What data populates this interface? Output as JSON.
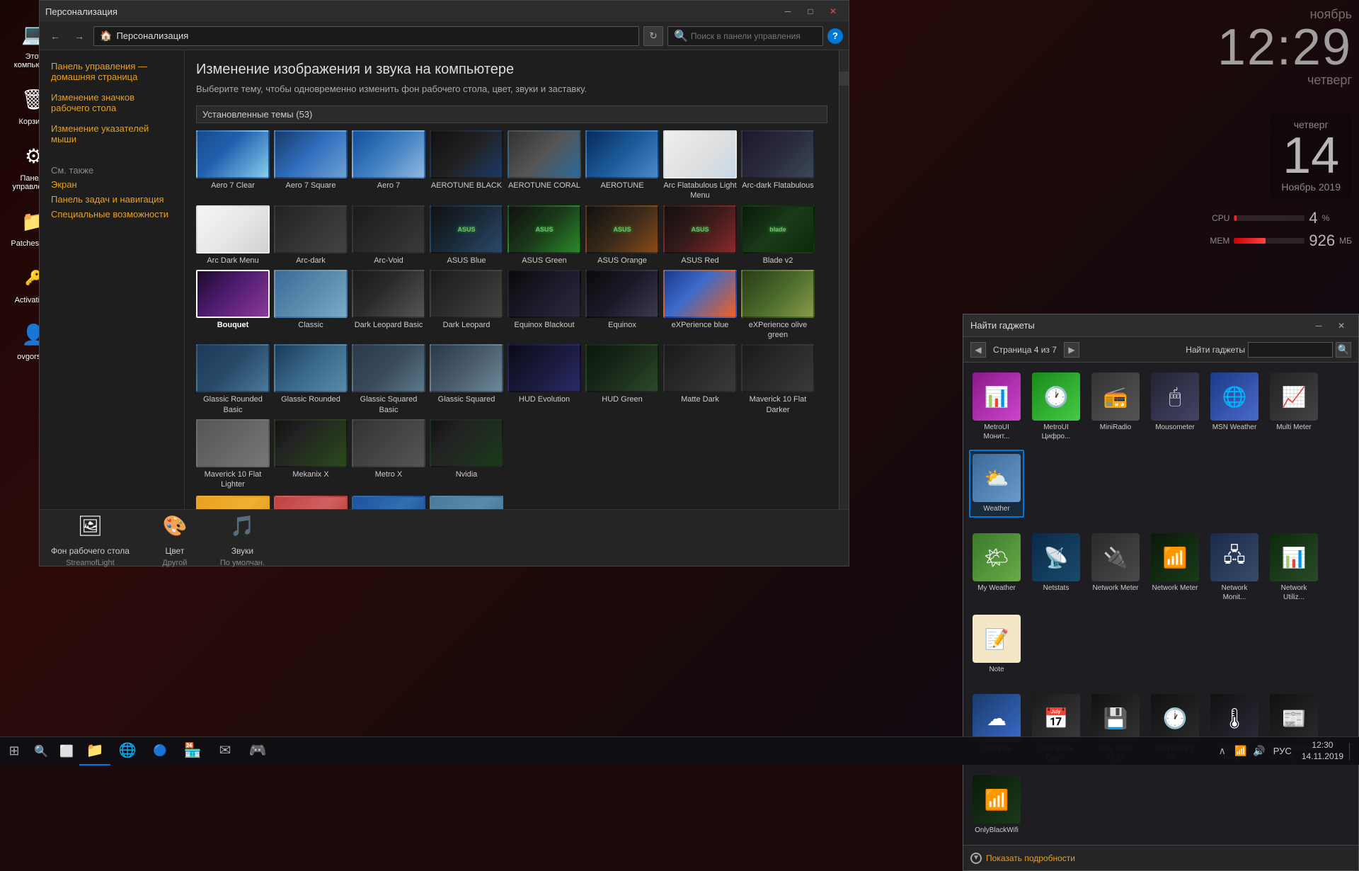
{
  "desktop": {
    "icons": [
      {
        "id": "computer",
        "label": "Этот компьютер",
        "icon": "💻"
      },
      {
        "id": "basket",
        "label": "Корзина",
        "icon": "🗑"
      },
      {
        "id": "control-panel",
        "label": "Панель управления",
        "icon": "⚙"
      },
      {
        "id": "patches",
        "label": "Patches_Fl...",
        "icon": "📁"
      },
      {
        "id": "activation",
        "label": "Activatior...",
        "icon": "🔑"
      },
      {
        "id": "ovgorskiy",
        "label": "ovgorskiy",
        "icon": "👤"
      }
    ]
  },
  "clock": {
    "time": "12:29",
    "month_label": "ноябрь",
    "day_num": "14",
    "day_name": "четверг"
  },
  "calendar": {
    "day_name": "четверг",
    "day_num": "14",
    "month_year": "Ноябрь 2019"
  },
  "cpu": {
    "label": "CPU",
    "value": "4",
    "unit": "%",
    "bar_pct": 4
  },
  "mem": {
    "label": "МЕМ",
    "value": "926",
    "unit": "МБ",
    "bar_pct": 45
  },
  "explorer": {
    "title": "Персонализация",
    "address_text": "Персонализация",
    "search_placeholder": "Поиск в панели управления",
    "main_title": "Изменение изображения и звука на компьютере",
    "main_subtitle": "Выберите тему, чтобы одновременно изменить фон рабочего стола, цвет, звуки и заставку.",
    "themes_section": "Установленные темы (53)",
    "sidebar_links": [
      "Панель управления — домашняя страница",
      "Изменение значков рабочего стола",
      "Изменение указателей мыши"
    ],
    "see_also_label": "См. также",
    "see_also_links": [
      "Экран",
      "Панель задач и навигация",
      "Специальные возможности"
    ],
    "themes": [
      {
        "label": "Aero 7 Clear",
        "cls": "t-aero7clear"
      },
      {
        "label": "Aero 7 Square",
        "cls": "t-aero7sq"
      },
      {
        "label": "Aero 7",
        "cls": "t-aero7"
      },
      {
        "label": "AEROTUNE BLACK",
        "cls": "t-aerotune-black"
      },
      {
        "label": "AEROTUNE CORAL",
        "cls": "t-aerotune-coral"
      },
      {
        "label": "AEROTUNE",
        "cls": "t-aerotune"
      },
      {
        "label": "Arc Flatabulous Light Menu",
        "cls": "t-arc-flat-light"
      },
      {
        "label": "Arc-dark Flatabulous",
        "cls": "t-arc-dark-flat"
      },
      {
        "label": "Arc Dark Menu",
        "cls": "t-arc-dark-menu"
      },
      {
        "label": "Arc-dark",
        "cls": "t-arc-dark"
      },
      {
        "label": "Arc-Void",
        "cls": "t-arc-void"
      },
      {
        "label": "ASUS Blue",
        "cls": "t-asus-blue"
      },
      {
        "label": "ASUS Green",
        "cls": "t-asus-green"
      },
      {
        "label": "ASUS Orange",
        "cls": "t-asus-orange"
      },
      {
        "label": "ASUS Red",
        "cls": "t-asus-red"
      },
      {
        "label": "Blade v2",
        "cls": "t-blade"
      },
      {
        "label": "Bouquet",
        "cls": "t-bouquet",
        "selected": true,
        "bold": true
      },
      {
        "label": "Classic",
        "cls": "t-classic"
      },
      {
        "label": "Dark Leopard Basic",
        "cls": "t-dark-leopard-basic"
      },
      {
        "label": "Dark Leopard",
        "cls": "t-dark-leopard"
      },
      {
        "label": "Equinox Blackout",
        "cls": "t-equinox-blackout"
      },
      {
        "label": "Equinox",
        "cls": "t-equinox"
      },
      {
        "label": "eXPerience blue",
        "cls": "t-exp-blue"
      },
      {
        "label": "eXPerience olive green",
        "cls": "t-exp-olive"
      },
      {
        "label": "Glassic Rounded Basic",
        "cls": "t-glassic-rb"
      },
      {
        "label": "Glassic Rounded",
        "cls": "t-glassic-r"
      },
      {
        "label": "Glassic Squared Basic",
        "cls": "t-glassic-sqb"
      },
      {
        "label": "Glassic Squared",
        "cls": "t-glassic-sq"
      },
      {
        "label": "HUD Evolution",
        "cls": "t-hud-evo"
      },
      {
        "label": "HUD Green",
        "cls": "t-hud-green"
      },
      {
        "label": "Matte Dark",
        "cls": "t-matte-dark"
      },
      {
        "label": "Maverick 10 Flat Darker",
        "cls": "t-mav-flat-darker"
      },
      {
        "label": "Maverick 10 Flat Lighter",
        "cls": "t-mav-flat-lighter"
      },
      {
        "label": "Mekanix X",
        "cls": "t-mekanix"
      },
      {
        "label": "Metro X",
        "cls": "t-metro-x"
      },
      {
        "label": "Nvidia",
        "cls": "t-nvidia"
      }
    ],
    "bottom_items": [
      {
        "label": "Фон рабочего стола",
        "sublabel": "StreamofLight",
        "icon": "🖼"
      },
      {
        "label": "Цвет",
        "sublabel": "Другой",
        "icon": "🎨"
      },
      {
        "label": "Звуки",
        "sublabel": "По умолчан.",
        "icon": "🎵"
      }
    ]
  },
  "gadget_panel": {
    "title": "Найти гаджеты",
    "page_info": "Страница 4 из 7",
    "gadgets_row1": [
      {
        "label": "MetroUI Монит...",
        "cls": "g-metroul",
        "icon": "📊"
      },
      {
        "label": "MetroUI Цифро...",
        "cls": "g-metroui-num",
        "icon": "🕐"
      },
      {
        "label": "MiniRadio",
        "cls": "g-miniradio",
        "icon": "📻"
      },
      {
        "label": "Mousometer",
        "cls": "g-mousometer",
        "icon": "🖱"
      },
      {
        "label": "MSN Weather",
        "cls": "g-msn",
        "icon": "🌐"
      },
      {
        "label": "Multi Meter",
        "cls": "g-multimeter",
        "icon": "📈"
      },
      {
        "label": "Weather",
        "cls": "g-weather",
        "icon": "⛅",
        "selected": true
      }
    ],
    "gadgets_row2": [
      {
        "label": "My Weather",
        "cls": "g-myweather",
        "icon": "🌤"
      },
      {
        "label": "Netstats",
        "cls": "g-netstats",
        "icon": "📡"
      },
      {
        "label": "Network Meter",
        "cls": "g-netmeter",
        "icon": "🔌"
      },
      {
        "label": "Network Meter",
        "cls": "g-netmeter2",
        "icon": "📶"
      },
      {
        "label": "Network Monit...",
        "cls": "g-netmon",
        "icon": "🖧"
      },
      {
        "label": "Network Utiliz...",
        "cls": "g-netutil",
        "icon": "📊"
      },
      {
        "label": "Note",
        "cls": "g-note",
        "icon": "📝"
      }
    ],
    "gadgets_row3": [
      {
        "label": "Onedrive",
        "cls": "g-onedrive",
        "icon": "☁"
      },
      {
        "label": "Only Black Cale...",
        "cls": "g-obcal",
        "icon": "📅"
      },
      {
        "label": "Only Black HDD",
        "cls": "g-obhdd",
        "icon": "💾"
      },
      {
        "label": "OnlyBlack 2 cl...",
        "cls": "g-ob2cl",
        "icon": "🕐"
      },
      {
        "label": "onlyBlack Weat...",
        "cls": "g-obweat",
        "icon": "🌡"
      },
      {
        "label": "OnlyBlackFeed...",
        "cls": "g-obfeed",
        "icon": "📰"
      },
      {
        "label": "OnlyBlackWifi",
        "cls": "g-obwifi",
        "icon": "📶"
      }
    ],
    "show_details_label": "Показать подробности"
  },
  "taskbar": {
    "apps": [
      {
        "label": "Start",
        "icon": "⊞"
      },
      {
        "label": "Search",
        "icon": "🔍"
      },
      {
        "label": "Task View",
        "icon": "⬜"
      },
      {
        "label": "File Explorer",
        "icon": "📁"
      },
      {
        "label": "IE",
        "icon": "🌐"
      },
      {
        "label": "Edge",
        "icon": "🔵"
      },
      {
        "label": "Windows Store",
        "icon": "🏪"
      },
      {
        "label": "Mail",
        "icon": "✉"
      },
      {
        "label": "App",
        "icon": "🎮"
      }
    ],
    "tray": {
      "time": "12:30",
      "date": "14.11.2019",
      "lang": "РУС"
    }
  }
}
